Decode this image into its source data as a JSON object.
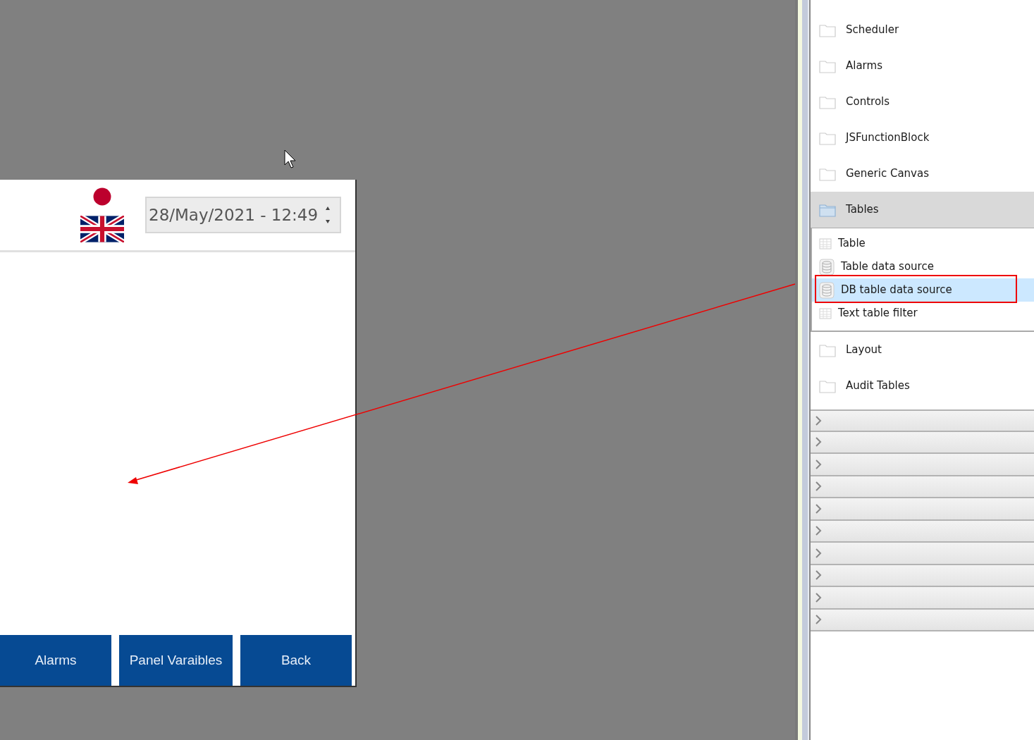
{
  "panel": {
    "flags": [
      {
        "kind": "japan"
      },
      {
        "kind": "uk"
      }
    ],
    "datetime": {
      "value": "28/May/2021 - 12:49"
    },
    "buttons": [
      "Alarms",
      "Panel Varaibles",
      "Back"
    ]
  },
  "palette": {
    "folders": [
      {
        "label": "Scheduler",
        "expanded": false
      },
      {
        "label": "Alarms",
        "expanded": false
      },
      {
        "label": "Controls",
        "expanded": false
      },
      {
        "label": "JSFunctionBlock",
        "expanded": false
      },
      {
        "label": "Generic Canvas",
        "expanded": false
      },
      {
        "label": "Tables",
        "expanded": true,
        "children": [
          {
            "label": "Table",
            "kind": "grid",
            "selected": false
          },
          {
            "label": "Table data source",
            "kind": "database",
            "selected": false
          },
          {
            "label": "DB table data source",
            "kind": "database",
            "selected": true
          },
          {
            "label": "Text table filter",
            "kind": "grid",
            "selected": false
          }
        ]
      },
      {
        "label": "Layout",
        "expanded": false
      },
      {
        "label": "Audit Tables",
        "expanded": false
      }
    ],
    "collapsed_groups": [
      {
        "expanded": false
      },
      {
        "expanded": false
      },
      {
        "expanded": false
      },
      {
        "expanded": false
      },
      {
        "expanded": false
      },
      {
        "expanded": false
      },
      {
        "expanded": false
      },
      {
        "expanded": false
      },
      {
        "expanded": false
      },
      {
        "expanded": false
      }
    ]
  }
}
